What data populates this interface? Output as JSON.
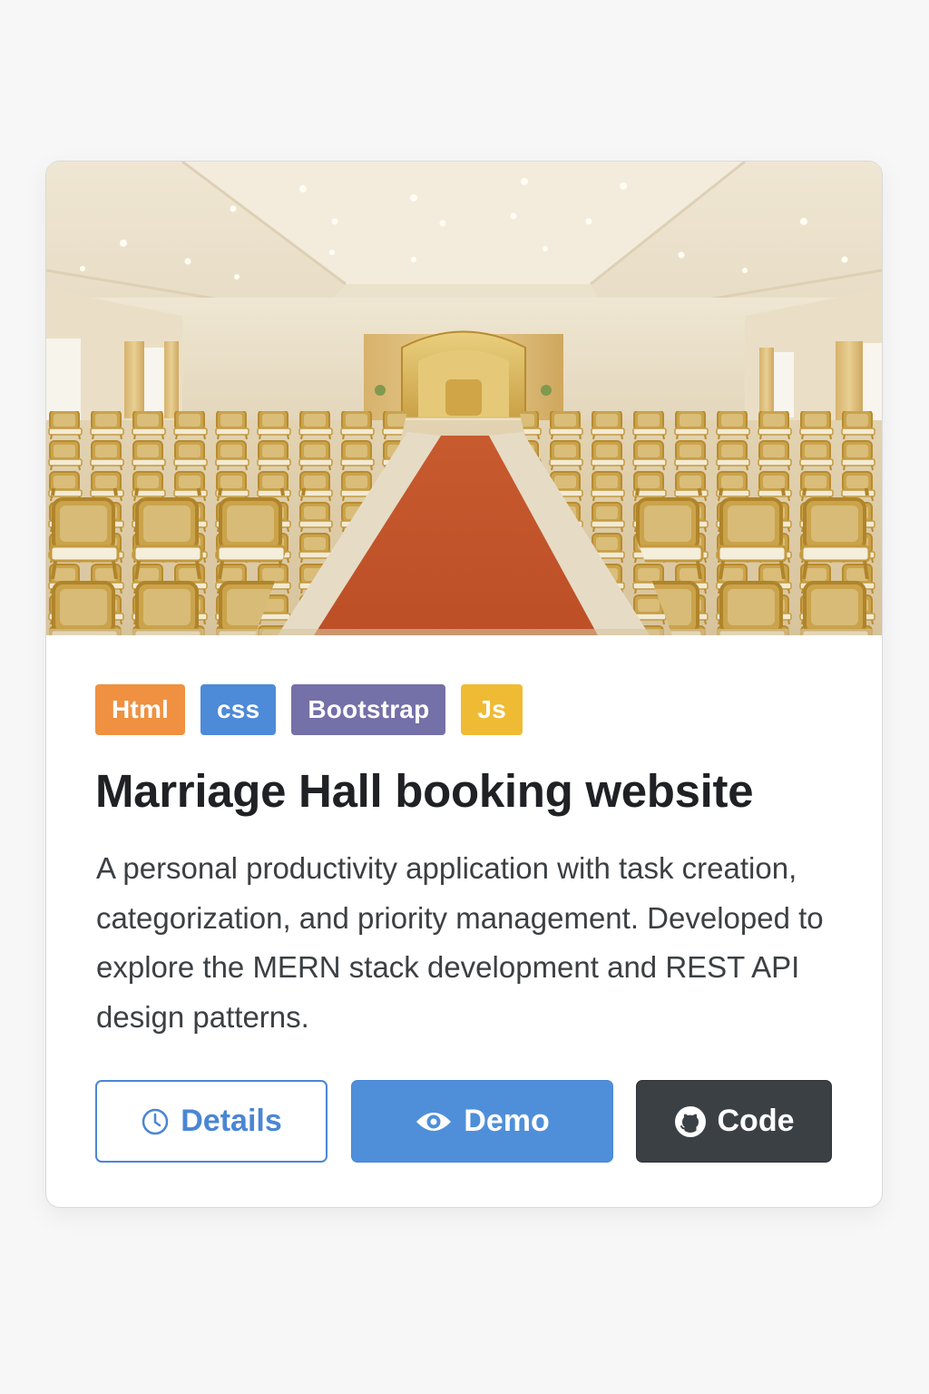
{
  "project": {
    "image_alt": "Marriage hall interior with rows of golden chairs and a red carpet aisle leading to a stage",
    "tags": [
      {
        "label": "Html",
        "color": "#ef9140"
      },
      {
        "label": "css",
        "color": "#4d8ad8"
      },
      {
        "label": "Bootstrap",
        "color": "#7470a8"
      },
      {
        "label": "Js",
        "color": "#f0bb34"
      }
    ],
    "title": "Marriage Hall booking website",
    "description": "A personal productivity application with task creation, categorization, and priority management. Developed to explore the MERN stack development and REST API design patterns."
  },
  "actions": {
    "details_label": "Details",
    "details_icon": "clock-icon",
    "demo_label": "Demo",
    "demo_icon": "eye-icon",
    "code_label": "Code",
    "code_icon": "github-icon"
  }
}
